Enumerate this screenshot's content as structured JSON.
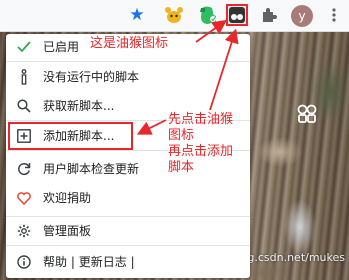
{
  "toolbar": {
    "avatar_initial": "y",
    "icons": [
      "star-icon",
      "mouse-extension-icon",
      "evernote-extension-icon",
      "tampermonkey-icon",
      "extensions-puzzle-icon",
      "more-menu-icon"
    ]
  },
  "menu": {
    "enabled": {
      "label": "已启用",
      "icon": "check-icon"
    },
    "no_scripts": {
      "label": "没有运行中的脚本",
      "icon": "info-icon"
    },
    "get_scripts": {
      "label": "获取新脚本...",
      "icon": "search-icon"
    },
    "add_script": {
      "label": "添加新脚本...",
      "icon": "plus-box-icon"
    },
    "check_updates": {
      "label": "用户脚本检查更新",
      "icon": "refresh-icon"
    },
    "donate": {
      "label": "欢迎捐助",
      "icon": "heart-icon"
    },
    "dashboard": {
      "label": "管理面板",
      "icon": "gear-icon"
    },
    "footer": {
      "help": "帮助",
      "sep1": "|",
      "changelog": "更新日志",
      "sep2": "|"
    }
  },
  "annotations": {
    "top": "这是油猴图标",
    "step_line1": "先点击油猴",
    "step_line2": "图标",
    "step_line3": "再点击添加",
    "step_line4": "脚本"
  },
  "watermark": "https://blog.csdn.net/mukes",
  "colors": {
    "annotation": "#e8272b",
    "check": "#34a853",
    "heart": "#ea4335",
    "star": "#1a73e8",
    "avatar": "#a87b78"
  }
}
